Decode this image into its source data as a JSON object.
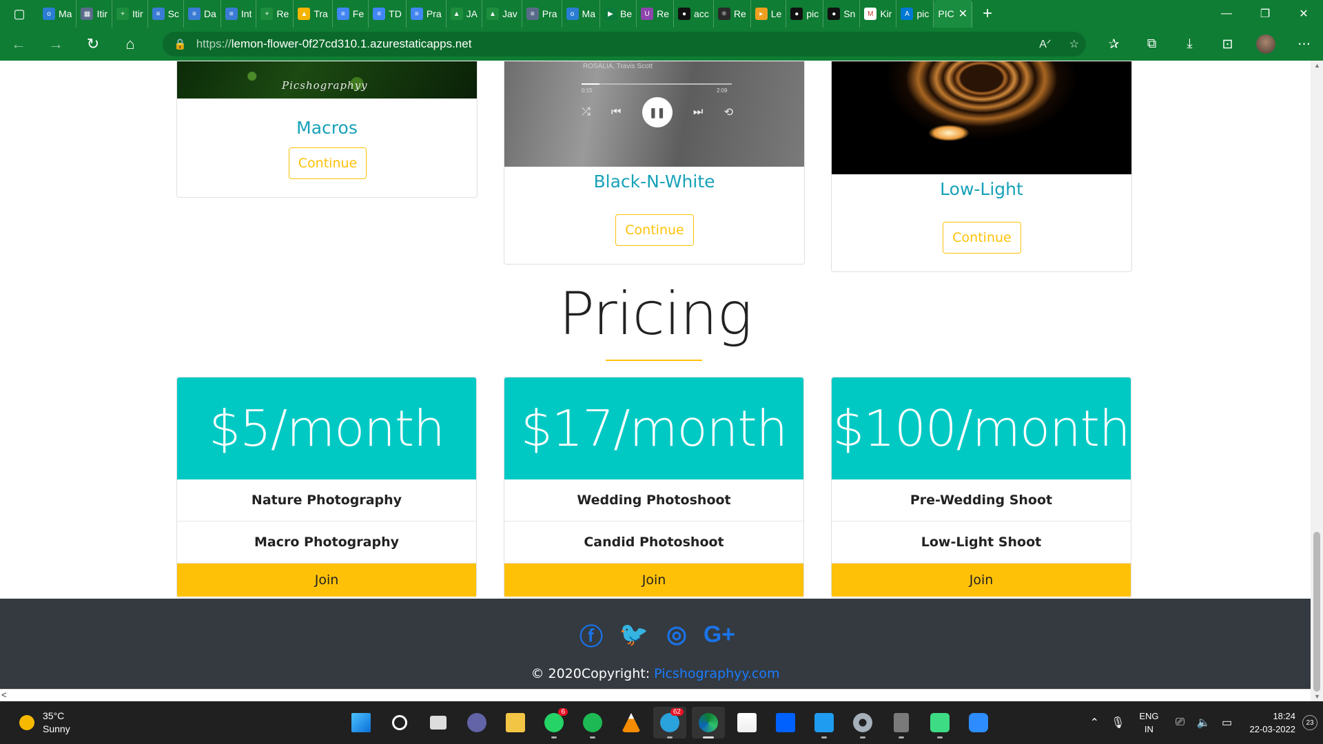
{
  "browser": {
    "tabs": [
      {
        "label": "Ma",
        "color": "#2b7cd3",
        "glyph": "o"
      },
      {
        "label": "Itir",
        "color": "#5a6b8a",
        "glyph": "▦"
      },
      {
        "label": "Itir",
        "color": "#1e8e3e",
        "glyph": "+"
      },
      {
        "label": "Sc",
        "color": "#3a7bd5",
        "glyph": "≡"
      },
      {
        "label": "Da",
        "color": "#3a7bd5",
        "glyph": "≡"
      },
      {
        "label": "Int",
        "color": "#3a7bd5",
        "glyph": "≡"
      },
      {
        "label": "Re",
        "color": "#1e8e3e",
        "glyph": "+"
      },
      {
        "label": "Tra",
        "color": "#f4b400",
        "glyph": "▲"
      },
      {
        "label": "Fe",
        "color": "#4285f4",
        "glyph": "≡"
      },
      {
        "label": "TD",
        "color": "#4285f4",
        "glyph": "≡"
      },
      {
        "label": "Pra",
        "color": "#4285f4",
        "glyph": "≡"
      },
      {
        "label": "JA",
        "color": "#1e8e3e",
        "glyph": "▲"
      },
      {
        "label": "Jav",
        "color": "#1e8e3e",
        "glyph": "▲"
      },
      {
        "label": "Pra",
        "color": "#5a6b8a",
        "glyph": "≡"
      },
      {
        "label": "Ma",
        "color": "#2b7cd3",
        "glyph": "o"
      },
      {
        "label": "Be",
        "color": "#0a7a3a",
        "glyph": "▶"
      },
      {
        "label": "Re",
        "color": "#8e44ad",
        "glyph": "U"
      },
      {
        "label": "acc",
        "color": "#111111",
        "glyph": "●"
      },
      {
        "label": "Re",
        "color": "#2a2a2a",
        "glyph": "⚛"
      },
      {
        "label": "Le",
        "color": "#f0a020",
        "glyph": "▸"
      },
      {
        "label": "pic",
        "color": "#111111",
        "glyph": "●"
      },
      {
        "label": "Sn",
        "color": "#111111",
        "glyph": "●"
      },
      {
        "label": "Kir",
        "color": "#ffffff",
        "glyph": "M"
      },
      {
        "label": "pic",
        "color": "#0078d4",
        "glyph": "A"
      },
      {
        "label": "PIC",
        "color": "",
        "glyph": ""
      }
    ],
    "url_protocol": "https://",
    "url_host": "lemon-flower-0f27cd310.1.azurestaticapps.net"
  },
  "gallery": {
    "cards": [
      {
        "title": "Macros",
        "button": "Continue",
        "watermark": "Picshographyy"
      },
      {
        "title": "Black-N-White",
        "button": "Continue",
        "player": {
          "artist": "ROSALIA, Travis Scott",
          "time_start": "0:15",
          "time_end": "2:09",
          "progress": 0.12
        }
      },
      {
        "title": "Low-Light",
        "button": "Continue"
      }
    ]
  },
  "pricing": {
    "title": "Pricing",
    "plans": [
      {
        "price": "$5/month",
        "features": [
          "Nature Photography",
          "Macro Photography"
        ],
        "button": "Join"
      },
      {
        "price": "$17/month",
        "features": [
          "Wedding Photoshoot",
          "Candid Photoshoot"
        ],
        "button": "Join"
      },
      {
        "price": "$100/month",
        "features": [
          "Pre-Wedding Shoot",
          "Low-Light Shoot"
        ],
        "button": "Join"
      }
    ]
  },
  "footer": {
    "social": [
      "facebook-icon",
      "twitter-icon",
      "instagram-icon",
      "google-plus-icon"
    ],
    "copyright": "© 2020Copyright:",
    "site_link": "Picshographyy.com"
  },
  "taskbar": {
    "temperature": "35°C",
    "condition": "Sunny",
    "whatsapp_badge": "6",
    "telegram_badge": "62",
    "language": "ENG",
    "region": "IN",
    "time": "18:24",
    "date": "22-03-2022",
    "notifications": "23"
  },
  "colors": {
    "accent_teal": "#00c9c4",
    "button_yellow": "#ffc107",
    "link_blue": "#17a2b8",
    "footer_bg": "#343a40",
    "browser_green": "#0f7d33"
  }
}
